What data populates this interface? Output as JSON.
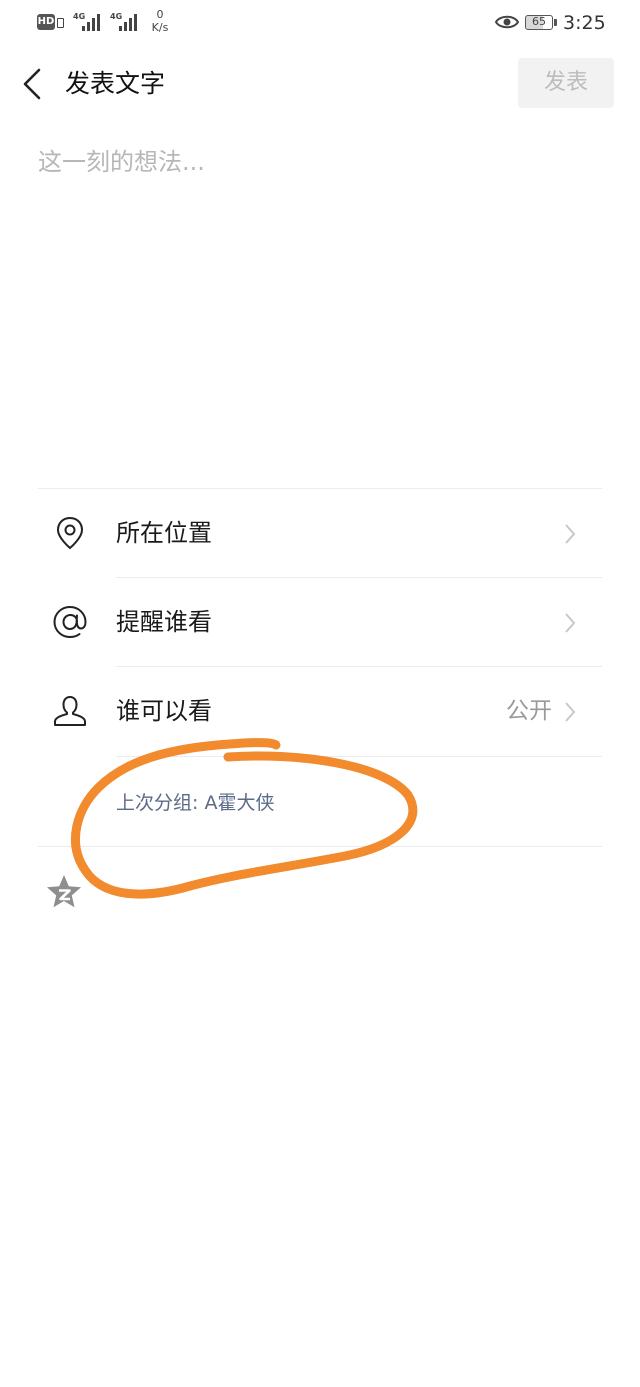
{
  "status_bar": {
    "hd_badge": "HD",
    "net_type_1": "4G",
    "net_type_2": "4G",
    "speed_value": "0",
    "speed_unit": "K/s",
    "battery_level": "65",
    "time": "3:25"
  },
  "header": {
    "title": "发表文字",
    "publish_label": "发表"
  },
  "composer": {
    "placeholder": "这一刻的想法..."
  },
  "options": {
    "location_label": "所在位置",
    "mention_label": "提醒谁看",
    "visibility_label": "谁可以看",
    "visibility_value": "公开"
  },
  "last_group": {
    "text": "上次分组: A霍大侠"
  },
  "colors": {
    "accent_link": "#5b6b88",
    "annotation_stroke": "#f28a2e",
    "disabled_button_bg": "#f2f2f2"
  },
  "icons": [
    "chevron-left-icon",
    "location-pin-icon",
    "at-sign-icon",
    "person-icon",
    "chevron-right-icon",
    "qzone-star-icon",
    "eye-icon"
  ]
}
